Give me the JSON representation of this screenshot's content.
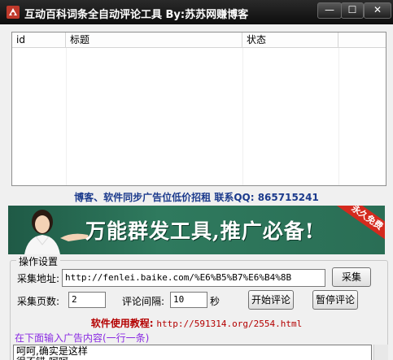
{
  "window": {
    "title": "互动百科词条全自动评论工具   By:苏苏网赚博客",
    "minimize_label": "—",
    "maximize_label": "☐",
    "close_label": "✕"
  },
  "list": {
    "columns": [
      "id",
      "标题",
      "状态"
    ]
  },
  "ad_line": "博客、软件同步广告位低价招租   联系QQ: 865715241",
  "banner": {
    "slogan": "万能群发工具,推广必备!",
    "ribbon": "永久免费"
  },
  "settings": {
    "group_title": "操作设置",
    "url_label": "采集地址:",
    "url_value": "http://fenlei.baike.com/%E6%B5%B7%E6%B4%8B",
    "collect_button": "采集",
    "pages_label": "采集页数:",
    "pages_value": "2",
    "interval_label": "评论间隔:",
    "interval_value": "10",
    "seconds_unit": "秒",
    "start_button": "开始评论",
    "pause_button": "暂停评论"
  },
  "tutorial": {
    "label": "软件使用教程:",
    "url": "http://591314.org/2554.html"
  },
  "ad_input_label": "在下面输入广告内容(一行一条)",
  "ad_content": "呵呵,确实是这样\n很不错,呵呵"
}
